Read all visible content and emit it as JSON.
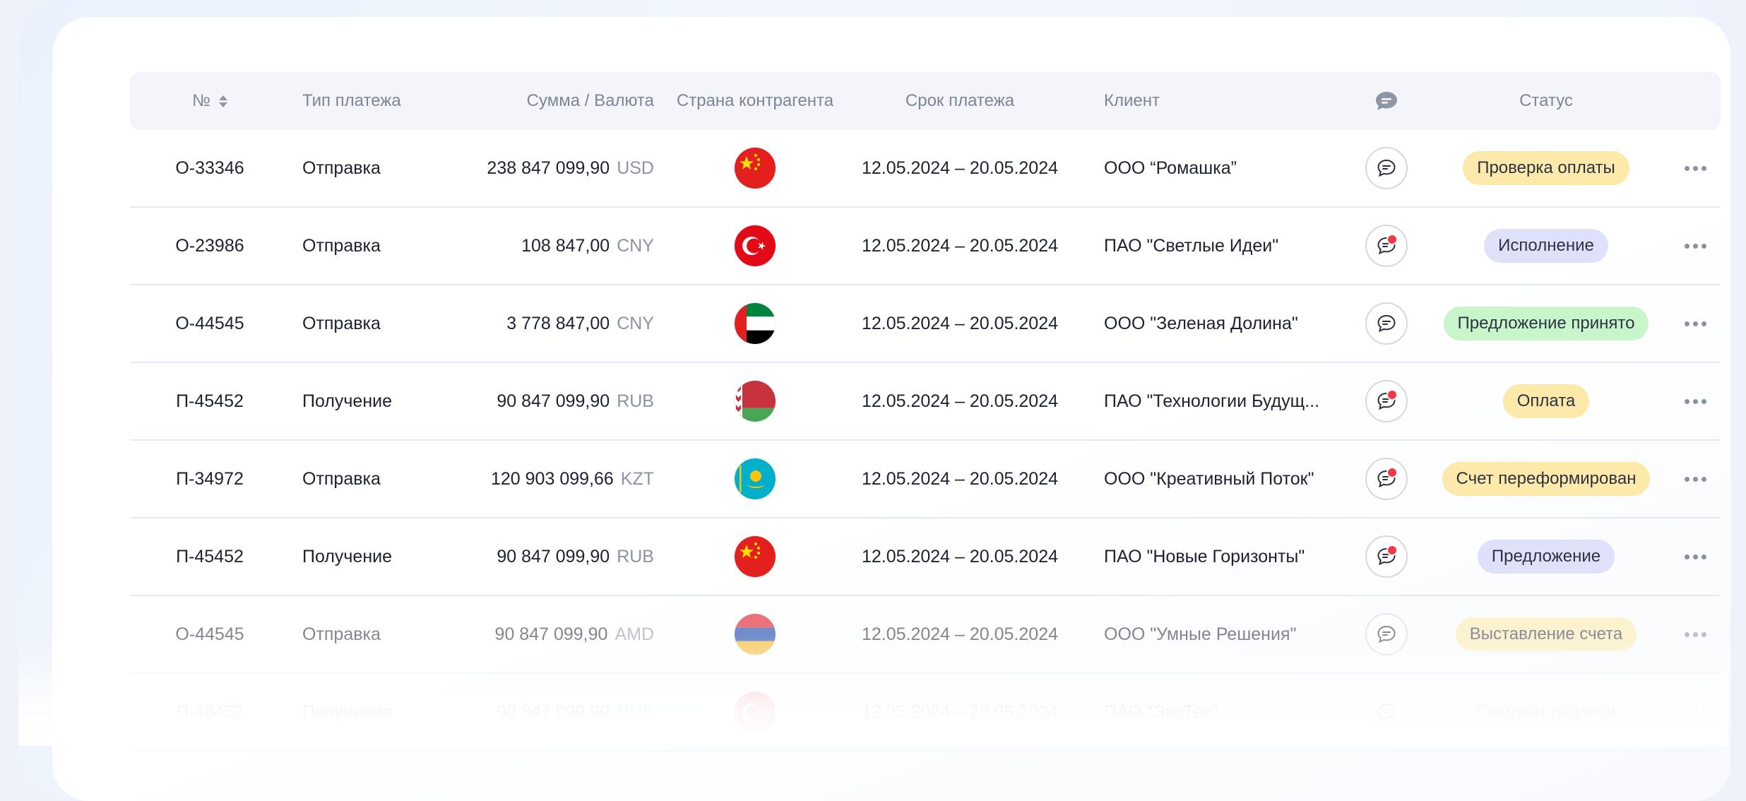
{
  "columns": {
    "number": "№",
    "type": "Тип платежа",
    "amount": "Сумма / Валюта",
    "country": "Страна контрагента",
    "due": "Срок платежа",
    "client": "Клиент",
    "status": "Статус"
  },
  "rows": [
    {
      "number": "О-33346",
      "type": "Отправка",
      "amount": "238 847 099,90",
      "currency": "USD",
      "flag": "china",
      "due": "12.05.2024 – 20.05.2024",
      "client": "ООО “Ромашка”",
      "unread": false,
      "status": "Проверка оплаты",
      "status_color": "yellow"
    },
    {
      "number": "О-23986",
      "type": "Отправка",
      "amount": "108 847,00",
      "currency": "CNY",
      "flag": "turkey",
      "due": "12.05.2024 – 20.05.2024",
      "client": "ПАО \"Светлые Идеи\"",
      "unread": true,
      "status": "Исполнение",
      "status_color": "lilac"
    },
    {
      "number": "О-44545",
      "type": "Отправка",
      "amount": "3 778 847,00",
      "currency": "CNY",
      "flag": "uae",
      "due": "12.05.2024 – 20.05.2024",
      "client": "ООО \"Зеленая Долина\"",
      "unread": false,
      "status": "Предложение принято",
      "status_color": "green"
    },
    {
      "number": "П-45452",
      "type": "Получение",
      "amount": "90 847 099,90",
      "currency": "RUB",
      "flag": "belarus",
      "due": "12.05.2024 – 20.05.2024",
      "client": "ПАО \"Технологии Будущ...",
      "unread": true,
      "status": "Оплата",
      "status_color": "yellow"
    },
    {
      "number": "П-34972",
      "type": "Отправка",
      "amount": "120 903 099,66",
      "currency": "KZT",
      "flag": "kazakhstan",
      "due": "12.05.2024 – 20.05.2024",
      "client": "ООО \"Креативный Поток\"",
      "unread": true,
      "status": "Счет переформирован",
      "status_color": "yellow"
    },
    {
      "number": "П-45452",
      "type": "Получение",
      "amount": "90 847 099,90",
      "currency": "RUB",
      "flag": "china",
      "due": "12.05.2024 – 20.05.2024",
      "client": "ПАО \"Новые Горизонты\"",
      "unread": true,
      "status": "Предложение",
      "status_color": "lilac"
    },
    {
      "number": "О-44545",
      "type": "Отправка",
      "amount": "90 847 099,90",
      "currency": "AMD",
      "flag": "armenia",
      "due": "12.05.2024 – 20.05.2024",
      "client": "ООО \"Умные Решения\"",
      "unread": false,
      "status": "Выставление счета",
      "status_color": "yellow"
    },
    {
      "number": "П-45452",
      "type": "Получение",
      "amount": "90 847 099,90",
      "currency": "RUB",
      "flag": "turkey",
      "due": "12.05.2024 – 20.05.2024",
      "client": "ПАО \"ЭкоТех\"",
      "unread": false,
      "status": "Ожидает подписи",
      "status_color": "gray"
    }
  ],
  "colors": {
    "yellow": "#fdeaaa",
    "lilac": "#dfe1fb",
    "green": "#c9f5cb",
    "gray": "#eef1f6",
    "unread_dot": "#f0384a"
  },
  "icons": {
    "sort": "sort-icon",
    "chat_header": "chat-bubble-icon",
    "chat_row": "chat-icon",
    "more": "more-horizontal-icon"
  }
}
